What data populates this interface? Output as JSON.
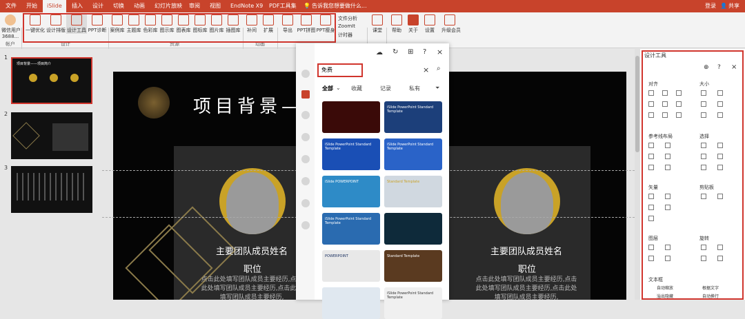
{
  "tabs": [
    "文件",
    "开始",
    "iSlide",
    "插入",
    "设计",
    "切换",
    "动画",
    "幻灯片放映",
    "审阅",
    "视图",
    "EndNote X9",
    "PDF工具集"
  ],
  "active_tab": "iSlide",
  "tell_me": "告诉我您想要做什么...",
  "login": "登录",
  "share": "共享",
  "ribbon": {
    "account": {
      "user": "微信用户",
      "sub": "3688...",
      "group": "帐户"
    },
    "design": [
      "一键优化",
      "设计排版",
      "设计工具",
      "PPT诊断"
    ],
    "design_group": "设计",
    "resources": [
      "案例库",
      "主题库",
      "色彩库",
      "图示库",
      "图表库",
      "图标库",
      "图片库",
      "插图库"
    ],
    "resources_group": "资源",
    "animation": [
      "补间",
      "扩展"
    ],
    "animation_group": "动画",
    "tools": [
      "导出",
      "PPT拼图",
      "PPT瘦身"
    ],
    "extras": [
      "文件分析",
      "ZoomIt",
      "计时器"
    ],
    "more": [
      "课堂",
      "帮助",
      "关于",
      "设置",
      "升级会员"
    ]
  },
  "thumbs": {
    "numbers": [
      "1",
      "2",
      "3"
    ],
    "t1_title": "项目背景——项目简介"
  },
  "slide": {
    "title": "项目背景——",
    "left_name": "主要团队成员姓名",
    "left_role": "职位",
    "left_desc": "点击此处填写团队成员主要经历,点击此处填写团队成员主要经历,点击此处填写团队成员主要经历,",
    "right_name": "主要团队成员姓名",
    "right_role": "职位",
    "right_desc": "点击此处填写团队成员主要经历,点击此处填写团队成员主要经历,点击此处填写团队成员主要经历,"
  },
  "popup": {
    "search_value": "免费",
    "categories": [
      "全部",
      "收藏",
      "记录",
      "私有"
    ],
    "templates": [
      {
        "text": "",
        "color": "#3a0a08"
      },
      {
        "text": "iSlide PowerPoint Standard Template",
        "color": "#1c3f7a"
      },
      {
        "text": "iSlide PowerPoint Standard Template",
        "color": "#1a4fb5"
      },
      {
        "text": "iSlide PowerPoint Standard Template",
        "color": "#2a63c8"
      },
      {
        "text": "iSlide POWERPOINT",
        "color": "#2e8bc7"
      },
      {
        "text": "Standard Template",
        "color": "#d0d8e0"
      },
      {
        "text": "iSlide PowerPoint Standard Template",
        "color": "#2a6bb0"
      },
      {
        "text": "",
        "color": "#0e2a3a"
      },
      {
        "text": "POWERPOINT",
        "color": "#e8e8e8"
      },
      {
        "text": "Standard Template",
        "color": "#5a3a20"
      },
      {
        "text": "",
        "color": "#e0e8f0"
      },
      {
        "text": "iSlide PowerPoint Standard Template",
        "color": "#f0f0f0"
      }
    ]
  },
  "rpanel": {
    "title": "设计工具",
    "sections": [
      "对齐",
      "大小",
      "参考线布局",
      "选择",
      "矢量",
      "剪贴板",
      "图层",
      "旋转",
      "文本框"
    ],
    "text_items": [
      "自动缩放",
      "根据文字",
      "溢出隐藏",
      "自动换行"
    ]
  }
}
